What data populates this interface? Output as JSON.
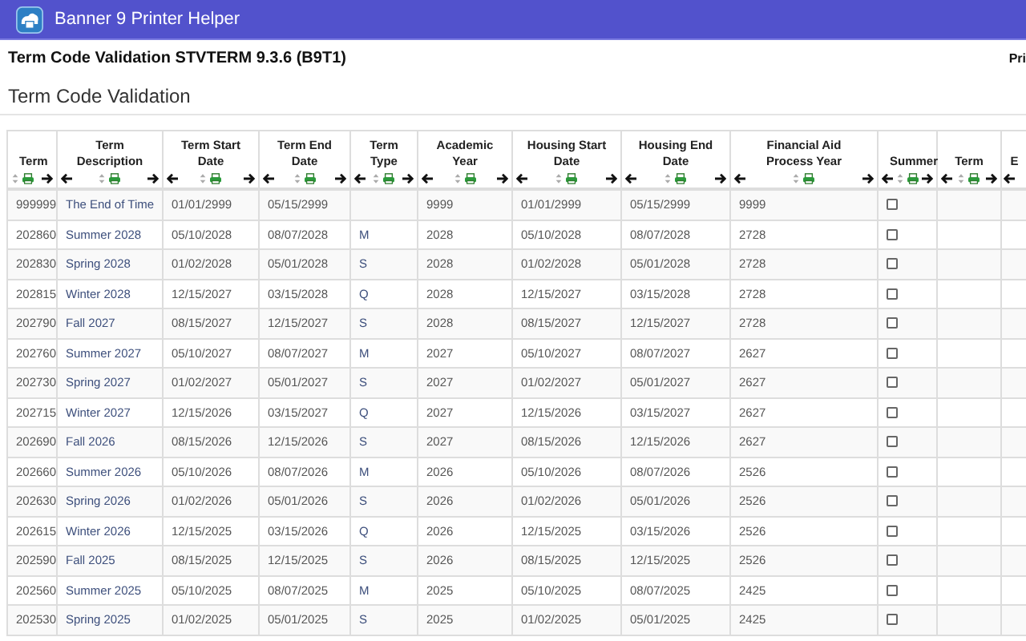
{
  "app_bar": {
    "title": "Banner 9 Printer Helper"
  },
  "page": {
    "heading": "Term Code Validation STVTERM 9.3.6 (B9T1)",
    "right_text": "Pri",
    "section_title": "Term Code Validation"
  },
  "table": {
    "columns": [
      {
        "label": "Term",
        "can_move_left": false
      },
      {
        "label": "Term Description",
        "can_move_left": true
      },
      {
        "label": "Term Start Date",
        "can_move_left": true
      },
      {
        "label": "Term End Date",
        "can_move_left": true
      },
      {
        "label": "Term Type",
        "can_move_left": true
      },
      {
        "label": "Academic Year",
        "can_move_left": true
      },
      {
        "label": "Housing Start Date",
        "can_move_left": true
      },
      {
        "label": "Housing End Date",
        "can_move_left": true
      },
      {
        "label": "Financial Aid Process Year",
        "can_move_left": true
      },
      {
        "label": "Summer",
        "can_move_left": true
      },
      {
        "label": "Term",
        "can_move_left": true
      },
      {
        "label": "E",
        "can_move_left": true
      }
    ],
    "rows": [
      {
        "term": "999999",
        "description": "The End of Time",
        "start": "01/01/2999",
        "end": "05/15/2999",
        "type": "",
        "academic_year": "9999",
        "housing_start": "01/01/2999",
        "housing_end": "05/15/2999",
        "aid_year": "9999",
        "summer": false
      },
      {
        "term": "202860",
        "description": "Summer 2028",
        "start": "05/10/2028",
        "end": "08/07/2028",
        "type": "M",
        "academic_year": "2028",
        "housing_start": "05/10/2028",
        "housing_end": "08/07/2028",
        "aid_year": "2728",
        "summer": false
      },
      {
        "term": "202830",
        "description": "Spring 2028",
        "start": "01/02/2028",
        "end": "05/01/2028",
        "type": "S",
        "academic_year": "2028",
        "housing_start": "01/02/2028",
        "housing_end": "05/01/2028",
        "aid_year": "2728",
        "summer": false
      },
      {
        "term": "202815",
        "description": "Winter 2028",
        "start": "12/15/2027",
        "end": "03/15/2028",
        "type": "Q",
        "academic_year": "2028",
        "housing_start": "12/15/2027",
        "housing_end": "03/15/2028",
        "aid_year": "2728",
        "summer": false
      },
      {
        "term": "202790",
        "description": "Fall 2027",
        "start": "08/15/2027",
        "end": "12/15/2027",
        "type": "S",
        "academic_year": "2028",
        "housing_start": "08/15/2027",
        "housing_end": "12/15/2027",
        "aid_year": "2728",
        "summer": false
      },
      {
        "term": "202760",
        "description": "Summer 2027",
        "start": "05/10/2027",
        "end": "08/07/2027",
        "type": "M",
        "academic_year": "2027",
        "housing_start": "05/10/2027",
        "housing_end": "08/07/2027",
        "aid_year": "2627",
        "summer": false
      },
      {
        "term": "202730",
        "description": "Spring 2027",
        "start": "01/02/2027",
        "end": "05/01/2027",
        "type": "S",
        "academic_year": "2027",
        "housing_start": "01/02/2027",
        "housing_end": "05/01/2027",
        "aid_year": "2627",
        "summer": false
      },
      {
        "term": "202715",
        "description": "Winter 2027",
        "start": "12/15/2026",
        "end": "03/15/2027",
        "type": "Q",
        "academic_year": "2027",
        "housing_start": "12/15/2026",
        "housing_end": "03/15/2027",
        "aid_year": "2627",
        "summer": false
      },
      {
        "term": "202690",
        "description": "Fall 2026",
        "start": "08/15/2026",
        "end": "12/15/2026",
        "type": "S",
        "academic_year": "2027",
        "housing_start": "08/15/2026",
        "housing_end": "12/15/2026",
        "aid_year": "2627",
        "summer": false
      },
      {
        "term": "202660",
        "description": "Summer 2026",
        "start": "05/10/2026",
        "end": "08/07/2026",
        "type": "M",
        "academic_year": "2026",
        "housing_start": "05/10/2026",
        "housing_end": "08/07/2026",
        "aid_year": "2526",
        "summer": false
      },
      {
        "term": "202630",
        "description": "Spring 2026",
        "start": "01/02/2026",
        "end": "05/01/2026",
        "type": "S",
        "academic_year": "2026",
        "housing_start": "01/02/2026",
        "housing_end": "05/01/2026",
        "aid_year": "2526",
        "summer": false
      },
      {
        "term": "202615",
        "description": "Winter 2026",
        "start": "12/15/2025",
        "end": "03/15/2026",
        "type": "Q",
        "academic_year": "2026",
        "housing_start": "12/15/2025",
        "housing_end": "03/15/2026",
        "aid_year": "2526",
        "summer": false
      },
      {
        "term": "202590",
        "description": "Fall 2025",
        "start": "08/15/2025",
        "end": "12/15/2025",
        "type": "S",
        "academic_year": "2026",
        "housing_start": "08/15/2025",
        "housing_end": "12/15/2025",
        "aid_year": "2526",
        "summer": false
      },
      {
        "term": "202560",
        "description": "Summer 2025",
        "start": "05/10/2025",
        "end": "08/07/2025",
        "type": "M",
        "academic_year": "2025",
        "housing_start": "05/10/2025",
        "housing_end": "08/07/2025",
        "aid_year": "2425",
        "summer": false
      },
      {
        "term": "202530",
        "description": "Spring 2025",
        "start": "01/02/2025",
        "end": "05/01/2025",
        "type": "S",
        "academic_year": "2025",
        "housing_start": "01/02/2025",
        "housing_end": "05/01/2025",
        "aid_year": "2425",
        "summer": false
      }
    ]
  }
}
